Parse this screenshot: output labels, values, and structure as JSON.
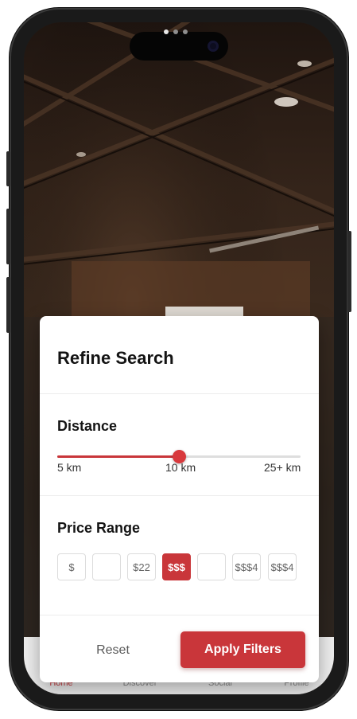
{
  "modal": {
    "title": "Refine Search",
    "distance": {
      "heading": "Distance",
      "min_label": "5 km",
      "mid_label": "10 km",
      "max_label": "25+ km",
      "value_fraction": 0.5
    },
    "price": {
      "heading": "Price Range",
      "options": [
        "$",
        "",
        "$22",
        "$$$",
        "",
        "$$$4",
        "$$$4"
      ],
      "selected_index": 3
    },
    "reset_label": "Reset",
    "apply_label": "Apply Filters"
  },
  "tabs": [
    {
      "label": "Home",
      "active": true
    },
    {
      "label": "Discover",
      "active": false
    },
    {
      "label": "Social",
      "active": false
    },
    {
      "label": "Profile",
      "active": false
    }
  ],
  "colors": {
    "accent": "#c9363a",
    "sheet_bg": "#ffffff",
    "track": "#dedede"
  },
  "icons": [
    "page-indicator-dots",
    "front-camera"
  ]
}
